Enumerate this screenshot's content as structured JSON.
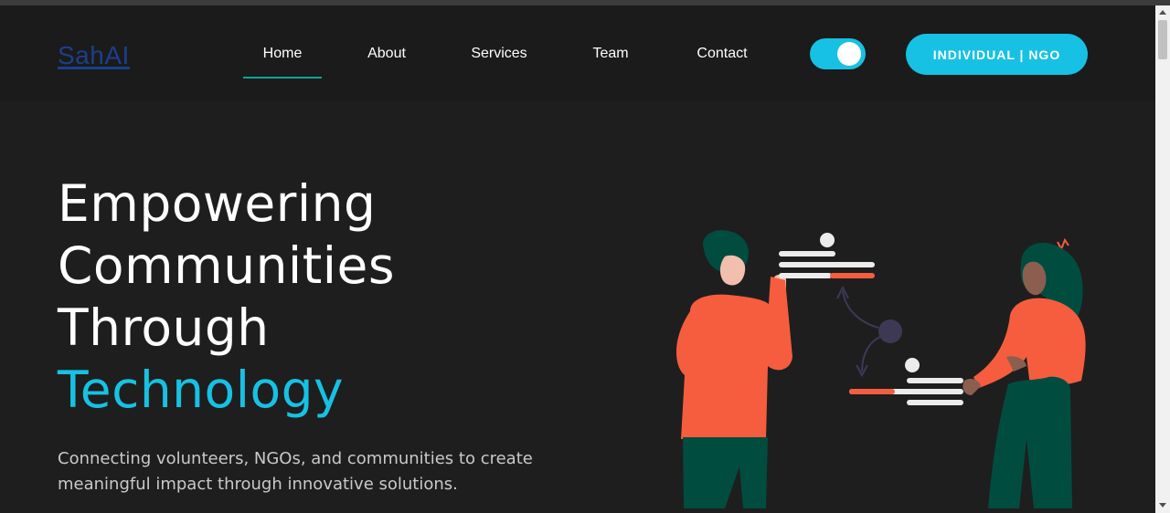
{
  "header": {
    "logo": "SahAI",
    "nav": [
      {
        "label": "Home",
        "active": true
      },
      {
        "label": "About",
        "active": false
      },
      {
        "label": "Services",
        "active": false
      },
      {
        "label": "Team",
        "active": false
      },
      {
        "label": "Contact",
        "active": false
      }
    ],
    "theme_toggle": {
      "state": "on"
    },
    "cta_label": "INDIVIDUAL | NGO"
  },
  "hero": {
    "title_lines": [
      "Empowering",
      "Communities",
      "Through"
    ],
    "title_accent": "Technology",
    "subtitle_line1": "Connecting volunteers, NGOs, and communities to create",
    "subtitle_line2": "meaningful impact through innovative solutions."
  },
  "colors": {
    "accent": "#17c1e3",
    "background": "#1e1e1e",
    "nav_underline": "#12a19a",
    "logo": "#1c3f8a",
    "figure_shirt": "#f55d3e",
    "figure_pants": "#004d40"
  },
  "icons": [
    "toggle-switch",
    "collaboration-illustration",
    "scroll-up-arrow",
    "scroll-down-arrow"
  ]
}
